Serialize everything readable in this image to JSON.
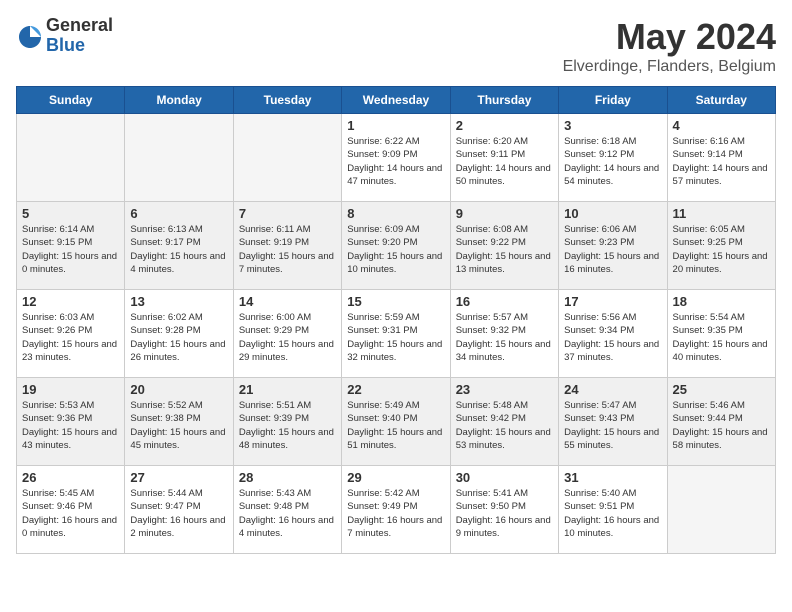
{
  "header": {
    "logo_general": "General",
    "logo_blue": "Blue",
    "title": "May 2024",
    "subtitle": "Elverdinge, Flanders, Belgium"
  },
  "weekdays": [
    "Sunday",
    "Monday",
    "Tuesday",
    "Wednesday",
    "Thursday",
    "Friday",
    "Saturday"
  ],
  "weeks": [
    [
      {
        "day": "",
        "empty": true
      },
      {
        "day": "",
        "empty": true
      },
      {
        "day": "",
        "empty": true
      },
      {
        "day": "1",
        "sunrise": "Sunrise: 6:22 AM",
        "sunset": "Sunset: 9:09 PM",
        "daylight": "Daylight: 14 hours and 47 minutes."
      },
      {
        "day": "2",
        "sunrise": "Sunrise: 6:20 AM",
        "sunset": "Sunset: 9:11 PM",
        "daylight": "Daylight: 14 hours and 50 minutes."
      },
      {
        "day": "3",
        "sunrise": "Sunrise: 6:18 AM",
        "sunset": "Sunset: 9:12 PM",
        "daylight": "Daylight: 14 hours and 54 minutes."
      },
      {
        "day": "4",
        "sunrise": "Sunrise: 6:16 AM",
        "sunset": "Sunset: 9:14 PM",
        "daylight": "Daylight: 14 hours and 57 minutes."
      }
    ],
    [
      {
        "day": "5",
        "sunrise": "Sunrise: 6:14 AM",
        "sunset": "Sunset: 9:15 PM",
        "daylight": "Daylight: 15 hours and 0 minutes."
      },
      {
        "day": "6",
        "sunrise": "Sunrise: 6:13 AM",
        "sunset": "Sunset: 9:17 PM",
        "daylight": "Daylight: 15 hours and 4 minutes."
      },
      {
        "day": "7",
        "sunrise": "Sunrise: 6:11 AM",
        "sunset": "Sunset: 9:19 PM",
        "daylight": "Daylight: 15 hours and 7 minutes."
      },
      {
        "day": "8",
        "sunrise": "Sunrise: 6:09 AM",
        "sunset": "Sunset: 9:20 PM",
        "daylight": "Daylight: 15 hours and 10 minutes."
      },
      {
        "day": "9",
        "sunrise": "Sunrise: 6:08 AM",
        "sunset": "Sunset: 9:22 PM",
        "daylight": "Daylight: 15 hours and 13 minutes."
      },
      {
        "day": "10",
        "sunrise": "Sunrise: 6:06 AM",
        "sunset": "Sunset: 9:23 PM",
        "daylight": "Daylight: 15 hours and 16 minutes."
      },
      {
        "day": "11",
        "sunrise": "Sunrise: 6:05 AM",
        "sunset": "Sunset: 9:25 PM",
        "daylight": "Daylight: 15 hours and 20 minutes."
      }
    ],
    [
      {
        "day": "12",
        "sunrise": "Sunrise: 6:03 AM",
        "sunset": "Sunset: 9:26 PM",
        "daylight": "Daylight: 15 hours and 23 minutes."
      },
      {
        "day": "13",
        "sunrise": "Sunrise: 6:02 AM",
        "sunset": "Sunset: 9:28 PM",
        "daylight": "Daylight: 15 hours and 26 minutes."
      },
      {
        "day": "14",
        "sunrise": "Sunrise: 6:00 AM",
        "sunset": "Sunset: 9:29 PM",
        "daylight": "Daylight: 15 hours and 29 minutes."
      },
      {
        "day": "15",
        "sunrise": "Sunrise: 5:59 AM",
        "sunset": "Sunset: 9:31 PM",
        "daylight": "Daylight: 15 hours and 32 minutes."
      },
      {
        "day": "16",
        "sunrise": "Sunrise: 5:57 AM",
        "sunset": "Sunset: 9:32 PM",
        "daylight": "Daylight: 15 hours and 34 minutes."
      },
      {
        "day": "17",
        "sunrise": "Sunrise: 5:56 AM",
        "sunset": "Sunset: 9:34 PM",
        "daylight": "Daylight: 15 hours and 37 minutes."
      },
      {
        "day": "18",
        "sunrise": "Sunrise: 5:54 AM",
        "sunset": "Sunset: 9:35 PM",
        "daylight": "Daylight: 15 hours and 40 minutes."
      }
    ],
    [
      {
        "day": "19",
        "sunrise": "Sunrise: 5:53 AM",
        "sunset": "Sunset: 9:36 PM",
        "daylight": "Daylight: 15 hours and 43 minutes."
      },
      {
        "day": "20",
        "sunrise": "Sunrise: 5:52 AM",
        "sunset": "Sunset: 9:38 PM",
        "daylight": "Daylight: 15 hours and 45 minutes."
      },
      {
        "day": "21",
        "sunrise": "Sunrise: 5:51 AM",
        "sunset": "Sunset: 9:39 PM",
        "daylight": "Daylight: 15 hours and 48 minutes."
      },
      {
        "day": "22",
        "sunrise": "Sunrise: 5:49 AM",
        "sunset": "Sunset: 9:40 PM",
        "daylight": "Daylight: 15 hours and 51 minutes."
      },
      {
        "day": "23",
        "sunrise": "Sunrise: 5:48 AM",
        "sunset": "Sunset: 9:42 PM",
        "daylight": "Daylight: 15 hours and 53 minutes."
      },
      {
        "day": "24",
        "sunrise": "Sunrise: 5:47 AM",
        "sunset": "Sunset: 9:43 PM",
        "daylight": "Daylight: 15 hours and 55 minutes."
      },
      {
        "day": "25",
        "sunrise": "Sunrise: 5:46 AM",
        "sunset": "Sunset: 9:44 PM",
        "daylight": "Daylight: 15 hours and 58 minutes."
      }
    ],
    [
      {
        "day": "26",
        "sunrise": "Sunrise: 5:45 AM",
        "sunset": "Sunset: 9:46 PM",
        "daylight": "Daylight: 16 hours and 0 minutes."
      },
      {
        "day": "27",
        "sunrise": "Sunrise: 5:44 AM",
        "sunset": "Sunset: 9:47 PM",
        "daylight": "Daylight: 16 hours and 2 minutes."
      },
      {
        "day": "28",
        "sunrise": "Sunrise: 5:43 AM",
        "sunset": "Sunset: 9:48 PM",
        "daylight": "Daylight: 16 hours and 4 minutes."
      },
      {
        "day": "29",
        "sunrise": "Sunrise: 5:42 AM",
        "sunset": "Sunset: 9:49 PM",
        "daylight": "Daylight: 16 hours and 7 minutes."
      },
      {
        "day": "30",
        "sunrise": "Sunrise: 5:41 AM",
        "sunset": "Sunset: 9:50 PM",
        "daylight": "Daylight: 16 hours and 9 minutes."
      },
      {
        "day": "31",
        "sunrise": "Sunrise: 5:40 AM",
        "sunset": "Sunset: 9:51 PM",
        "daylight": "Daylight: 16 hours and 10 minutes."
      },
      {
        "day": "",
        "empty": true
      }
    ]
  ]
}
